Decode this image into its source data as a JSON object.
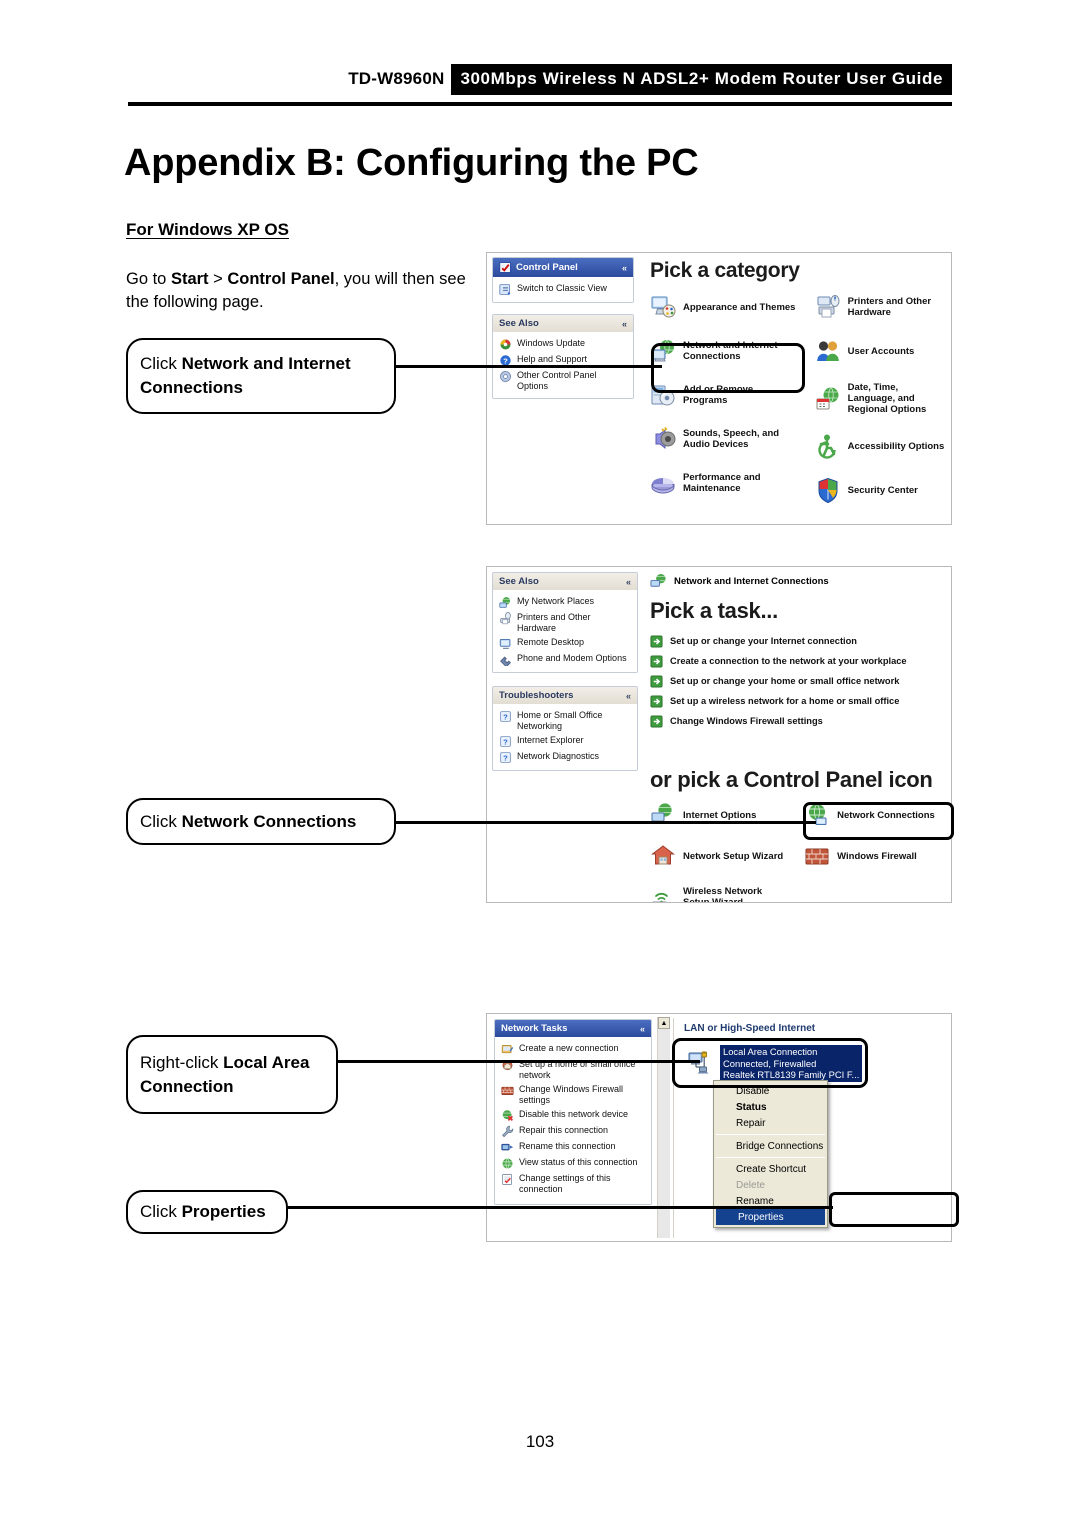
{
  "header": {
    "model": "TD-W8960N",
    "title": "300Mbps Wireless N ADSL2+ Modem Router User Guide"
  },
  "page_title": "Appendix B: Configuring the PC",
  "section_title": "For Windows XP OS",
  "intro": {
    "prefix": "Go to ",
    "bold1": "Start",
    "mid": " > ",
    "bold2": "Control Panel",
    "suffix": ", you will then see the following page."
  },
  "callouts": {
    "one": {
      "plain": "Click ",
      "bold": "Network and Internet Connections"
    },
    "two": {
      "plain": "Click ",
      "bold": "Network Connections"
    },
    "three": {
      "plain": "Right-click ",
      "bold": "Local Area Connection"
    },
    "four": {
      "plain": "Click ",
      "bold": "Properties"
    }
  },
  "shot1": {
    "sidebar": {
      "panel1": {
        "title": "Control Panel",
        "chevron": "«",
        "items": [
          {
            "label": "Switch to Classic View",
            "icon": "switch-view-icon"
          }
        ]
      },
      "panel2": {
        "title": "See Also",
        "chevron": "«",
        "items": [
          {
            "label": "Windows Update",
            "icon": "windows-update-icon"
          },
          {
            "label": "Help and Support",
            "icon": "help-support-icon"
          },
          {
            "label": "Other Control Panel Options",
            "icon": "other-options-icon"
          }
        ]
      }
    },
    "heading": "Pick a category",
    "categories": [
      {
        "label": "Appearance and Themes",
        "icon": "appearance-themes-icon"
      },
      {
        "label": "Printers and Other Hardware",
        "icon": "printers-hardware-icon"
      },
      {
        "label": "Network and Internet Connections",
        "icon": "network-internet-icon",
        "highlighted": true
      },
      {
        "label": "User Accounts",
        "icon": "user-accounts-icon"
      },
      {
        "label": "Add or Remove Programs",
        "icon": "add-remove-programs-icon"
      },
      {
        "label": "Date, Time, Language, and Regional Options",
        "icon": "date-time-icon"
      },
      {
        "label": "Sounds, Speech, and Audio Devices",
        "icon": "sounds-audio-icon"
      },
      {
        "label": "Accessibility Options",
        "icon": "accessibility-icon"
      },
      {
        "label": "Performance and Maintenance",
        "icon": "performance-icon"
      },
      {
        "label": "Security Center",
        "icon": "security-center-icon"
      }
    ]
  },
  "shot2": {
    "sidebar": {
      "panel1": {
        "title": "See Also",
        "chevron": "«",
        "items": [
          {
            "label": "My Network Places",
            "icon": "my-network-places-icon"
          },
          {
            "label": "Printers and Other Hardware",
            "icon": "printers-hardware-icon"
          },
          {
            "label": "Remote Desktop",
            "icon": "remote-desktop-icon"
          },
          {
            "label": "Phone and Modem Options",
            "icon": "phone-modem-icon"
          }
        ]
      },
      "panel2": {
        "title": "Troubleshooters",
        "chevron": "«",
        "items": [
          {
            "label": "Home or Small Office Networking",
            "icon": "help-question-icon"
          },
          {
            "label": "Internet Explorer",
            "icon": "help-question-icon"
          },
          {
            "label": "Network Diagnostics",
            "icon": "help-question-icon"
          }
        ]
      }
    },
    "breadcrumb": "Network and Internet Connections",
    "heading_task": "Pick a task...",
    "tasks": [
      "Set up or change your Internet connection",
      "Create a connection to the network at your workplace",
      "Set up or change your home or small office network",
      "Set up a wireless network for a home or small office",
      "Change Windows Firewall settings"
    ],
    "heading_icons": "or pick a Control Panel icon",
    "cp_icons": [
      {
        "label": "Internet Options",
        "icon": "internet-options-icon"
      },
      {
        "label": "Network Connections",
        "icon": "network-connections-icon",
        "highlighted": true
      },
      {
        "label": "Network Setup Wizard",
        "icon": "network-setup-wizard-icon"
      },
      {
        "label": "Windows Firewall",
        "icon": "windows-firewall-icon"
      },
      {
        "label": "Wireless Network Setup Wizard",
        "icon": "wireless-setup-wizard-icon"
      }
    ]
  },
  "shot3": {
    "sidebar": {
      "panel1": {
        "title": "Network Tasks",
        "chevron": "«",
        "items": [
          {
            "label": "Create a new connection",
            "icon": "new-connection-icon"
          },
          {
            "label": "Set up a home or small office network",
            "icon": "home-network-icon"
          },
          {
            "label": "Change Windows Firewall settings",
            "icon": "firewall-icon"
          },
          {
            "label": "Disable this network device",
            "icon": "disable-device-icon"
          },
          {
            "label": "Repair this connection",
            "icon": "repair-icon"
          },
          {
            "label": "Rename this connection",
            "icon": "rename-icon"
          },
          {
            "label": "View status of this connection",
            "icon": "view-status-icon"
          },
          {
            "label": "Change settings of this connection",
            "icon": "change-settings-icon"
          }
        ]
      }
    },
    "group_label": "LAN or High-Speed Internet",
    "connection": {
      "name": "Local Area Connection",
      "status": "Connected, Firewalled",
      "adapter": "Realtek RTL8139 Family PCI F...",
      "icon": "lan-connection-icon"
    },
    "context_menu": [
      {
        "label": "Disable",
        "state": "normal"
      },
      {
        "label": "Status",
        "state": "bold"
      },
      {
        "label": "Repair",
        "state": "normal"
      },
      {
        "separator": true
      },
      {
        "label": "Bridge Connections",
        "state": "normal"
      },
      {
        "separator": true
      },
      {
        "label": "Create Shortcut",
        "state": "normal"
      },
      {
        "label": "Delete",
        "state": "disabled"
      },
      {
        "label": "Rename",
        "state": "normal"
      },
      {
        "label": "Properties",
        "state": "selected"
      }
    ]
  },
  "page_number": "103",
  "colors": {
    "highlight_select": "#0a246a",
    "menu_select": "#14428f",
    "panel_blue": "#2c4a9e",
    "panel_tan": "#e3ded2"
  }
}
